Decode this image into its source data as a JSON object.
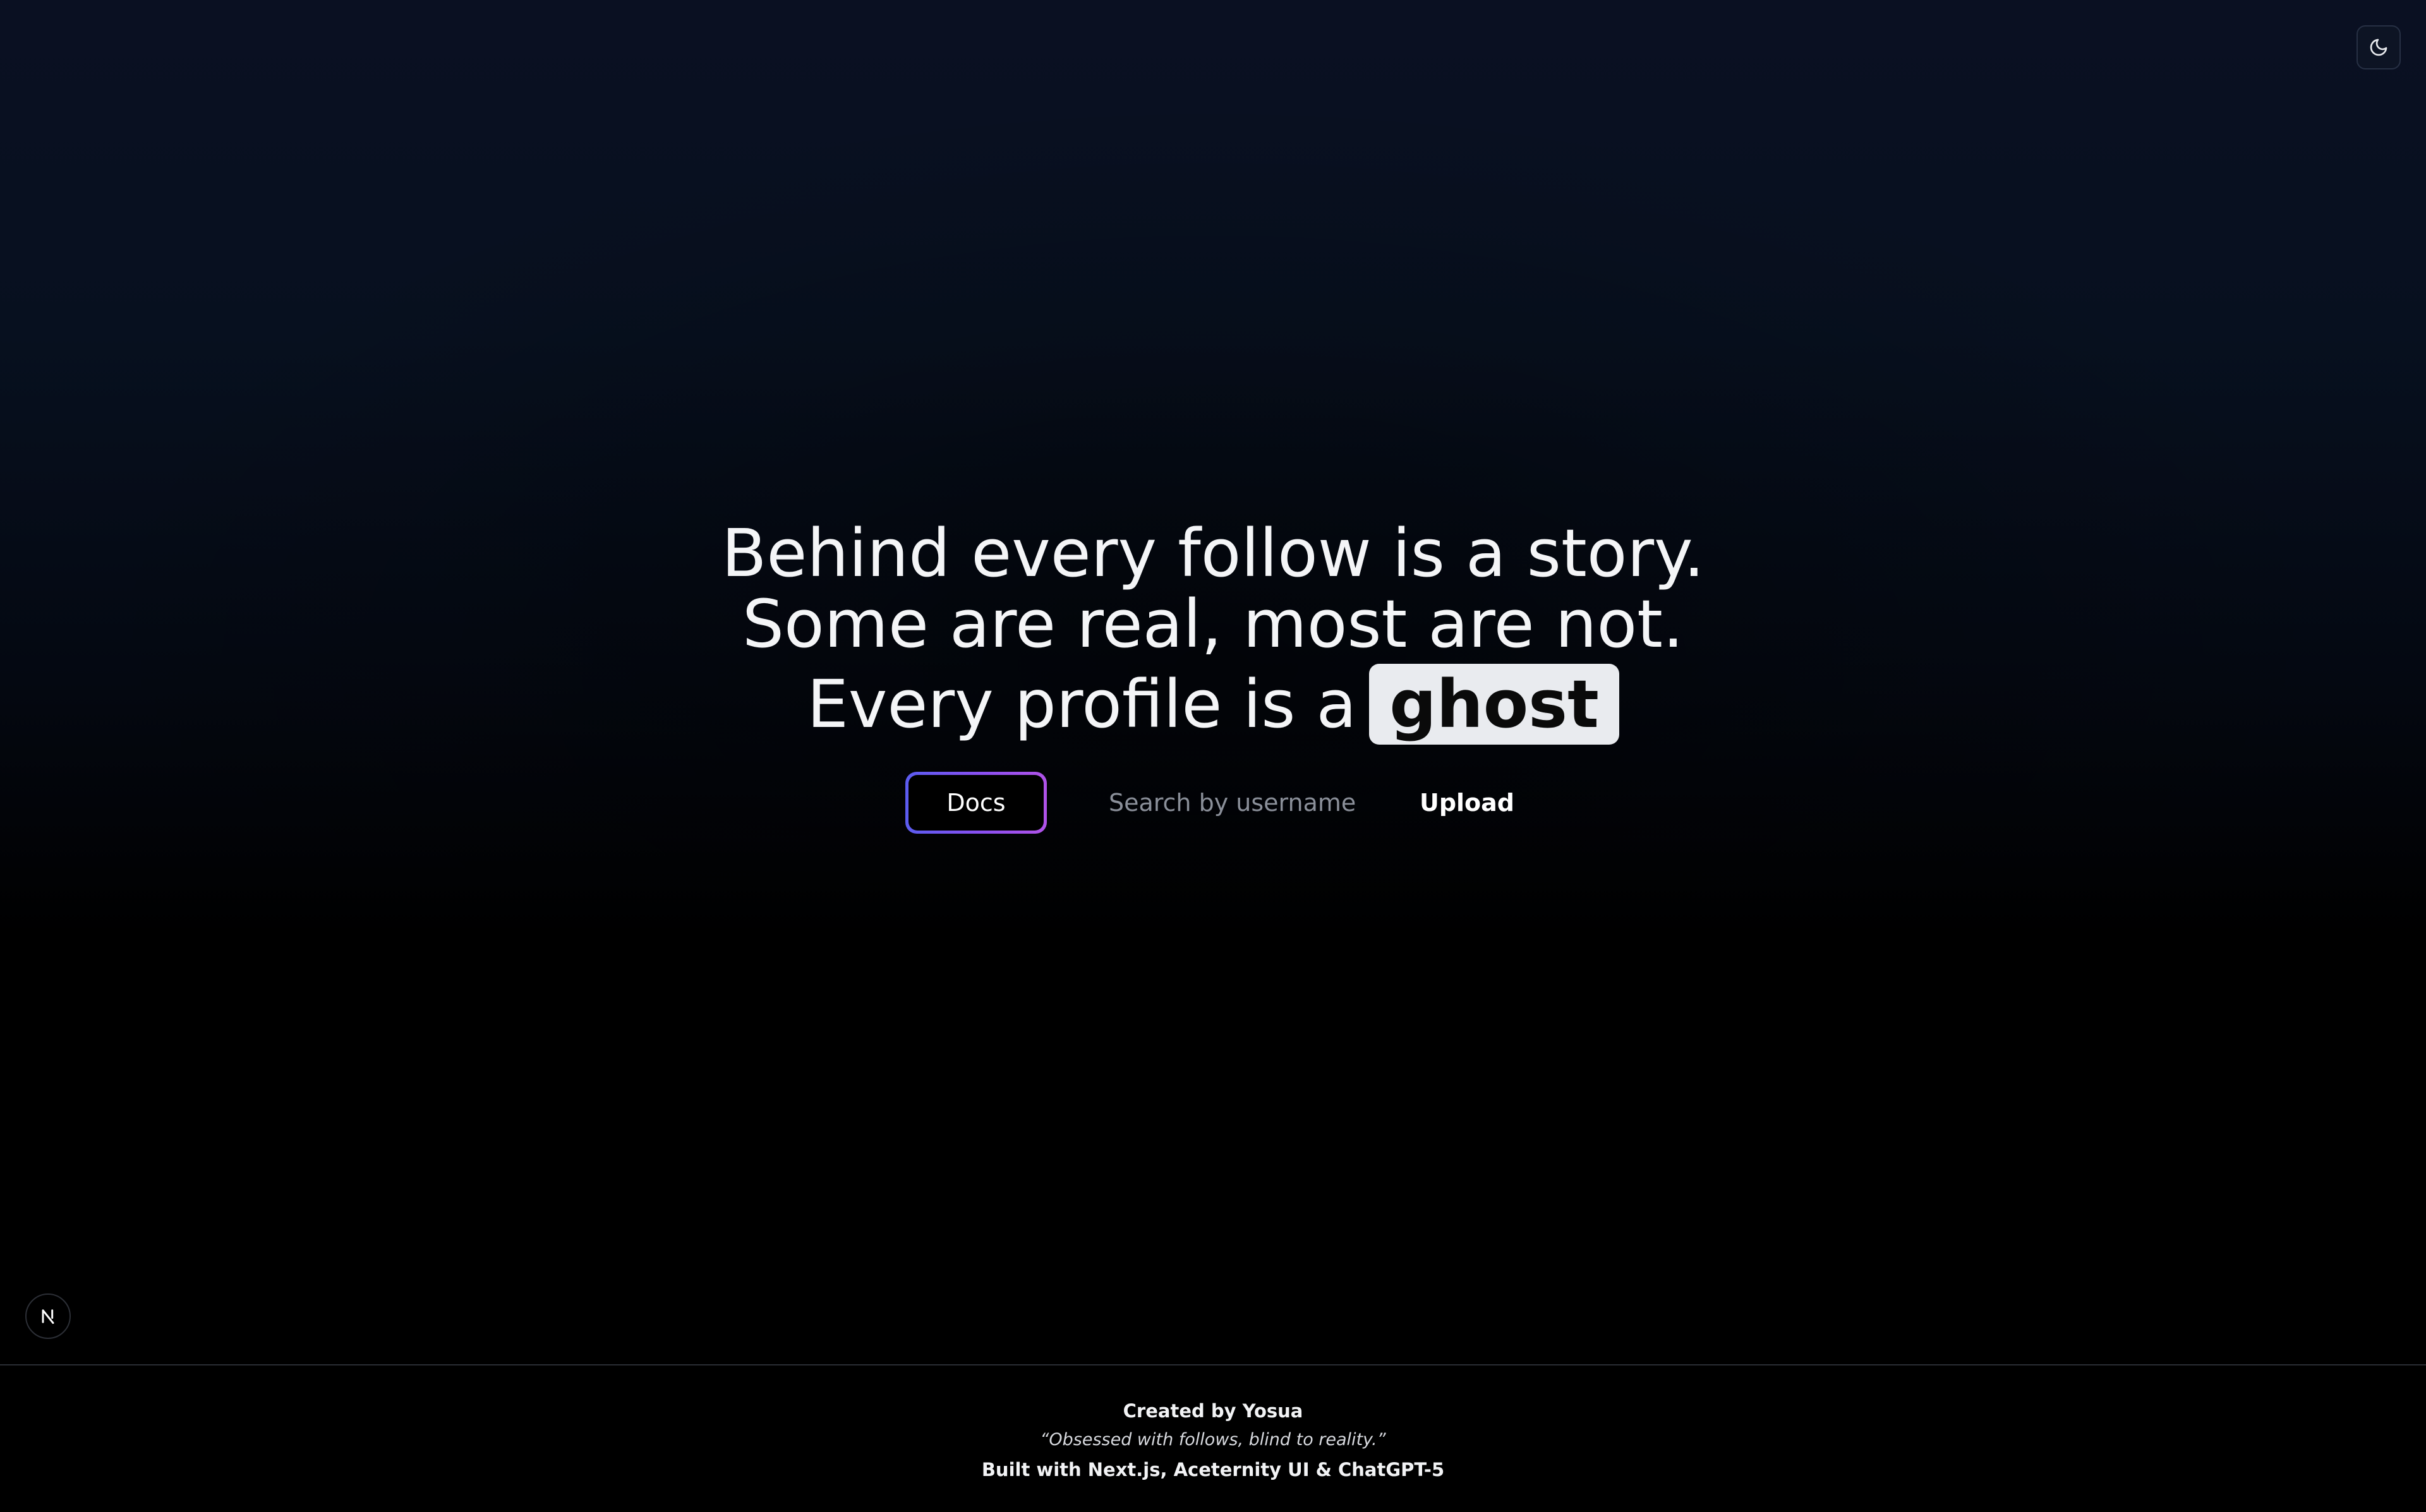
{
  "theme_toggle": {
    "icon": "moon-icon"
  },
  "hero": {
    "line1": "Behind every follow is a story.",
    "line2": "Some are real, most are not.",
    "line3_prefix": "Every profile is a",
    "highlight": "ghost"
  },
  "actions": {
    "docs_label": "Docs",
    "search_placeholder": "Search by username",
    "search_value": "",
    "upload_label": "Upload"
  },
  "next_badge": {
    "letter": "N"
  },
  "footer": {
    "credit": "Created by Yosua",
    "quote": "“Obsessed with follows, blind to reality.”",
    "built_with": "Built with Next.js, Aceternity UI & ChatGPT-5"
  },
  "colors": {
    "background_top": "#0a1022",
    "background_bottom": "#000000",
    "docs_gradient_start": "#5b5cf0",
    "docs_gradient_end": "#b052e8",
    "highlight_bg": "#e9ebef"
  }
}
